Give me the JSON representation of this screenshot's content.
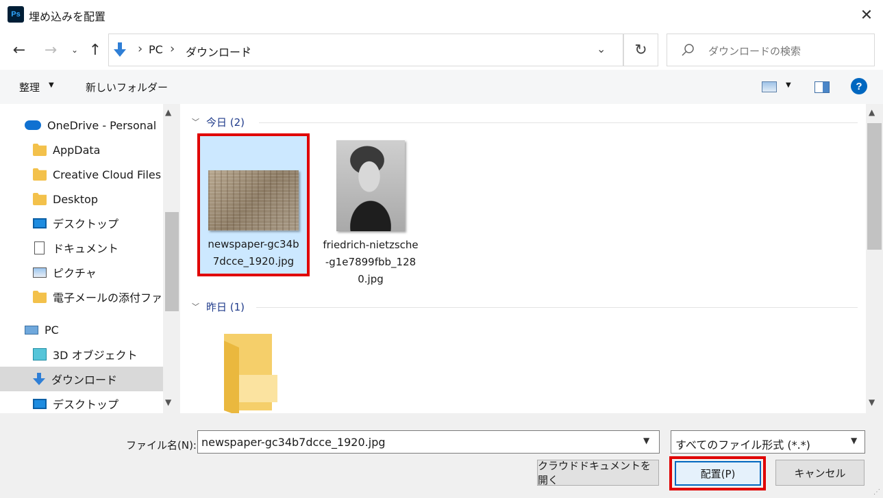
{
  "window": {
    "title": "埋め込みを配置",
    "app_badge": "Ps"
  },
  "address": {
    "path": [
      "PC",
      "ダウンロード"
    ],
    "search_placeholder": "ダウンロードの検索"
  },
  "toolbar": {
    "organize": "整理",
    "new_folder": "新しいフォルダー",
    "help": "?"
  },
  "nav": {
    "items": [
      {
        "label": "OneDrive - Personal",
        "icon": "onedrive-cloud-icon"
      },
      {
        "label": "AppData",
        "icon": "folder-icon"
      },
      {
        "label": "Creative Cloud Files",
        "icon": "folder-icon"
      },
      {
        "label": "Desktop",
        "icon": "folder-icon"
      },
      {
        "label": "デスクトップ",
        "icon": "desktop-icon"
      },
      {
        "label": "ドキュメント",
        "icon": "documents-icon"
      },
      {
        "label": "ピクチャ",
        "icon": "pictures-icon"
      },
      {
        "label": "電子メールの添付ファイル",
        "icon": "folder-icon"
      },
      {
        "label": "PC",
        "icon": "pc-icon"
      },
      {
        "label": "3D オブジェクト",
        "icon": "3d-objects-icon"
      },
      {
        "label": "ダウンロード",
        "icon": "download-icon",
        "selected": true
      },
      {
        "label": "デスクトップ",
        "icon": "desktop-icon"
      }
    ]
  },
  "content": {
    "groups": [
      {
        "header": "今日 (2)"
      },
      {
        "header": "昨日 (1)"
      }
    ],
    "files": [
      {
        "name": "newspaper-gc34b7dcce_1920.jpg",
        "selected": true
      },
      {
        "name": "friedrich-nietzsche-g1e7899fbb_1280.jpg"
      }
    ]
  },
  "footer": {
    "filename_label": "ファイル名(N):",
    "filename_value": "newspaper-gc34b7dcce_1920.jpg",
    "filetype_value": "すべてのファイル形式 (*.*)",
    "cloud_button": "クラウドドキュメントを開く",
    "place_button": "配置(P)",
    "cancel_button": "キャンセル"
  },
  "colors": {
    "highlight": "#e00000",
    "selection": "#cce8ff",
    "accent": "#0067c0"
  }
}
